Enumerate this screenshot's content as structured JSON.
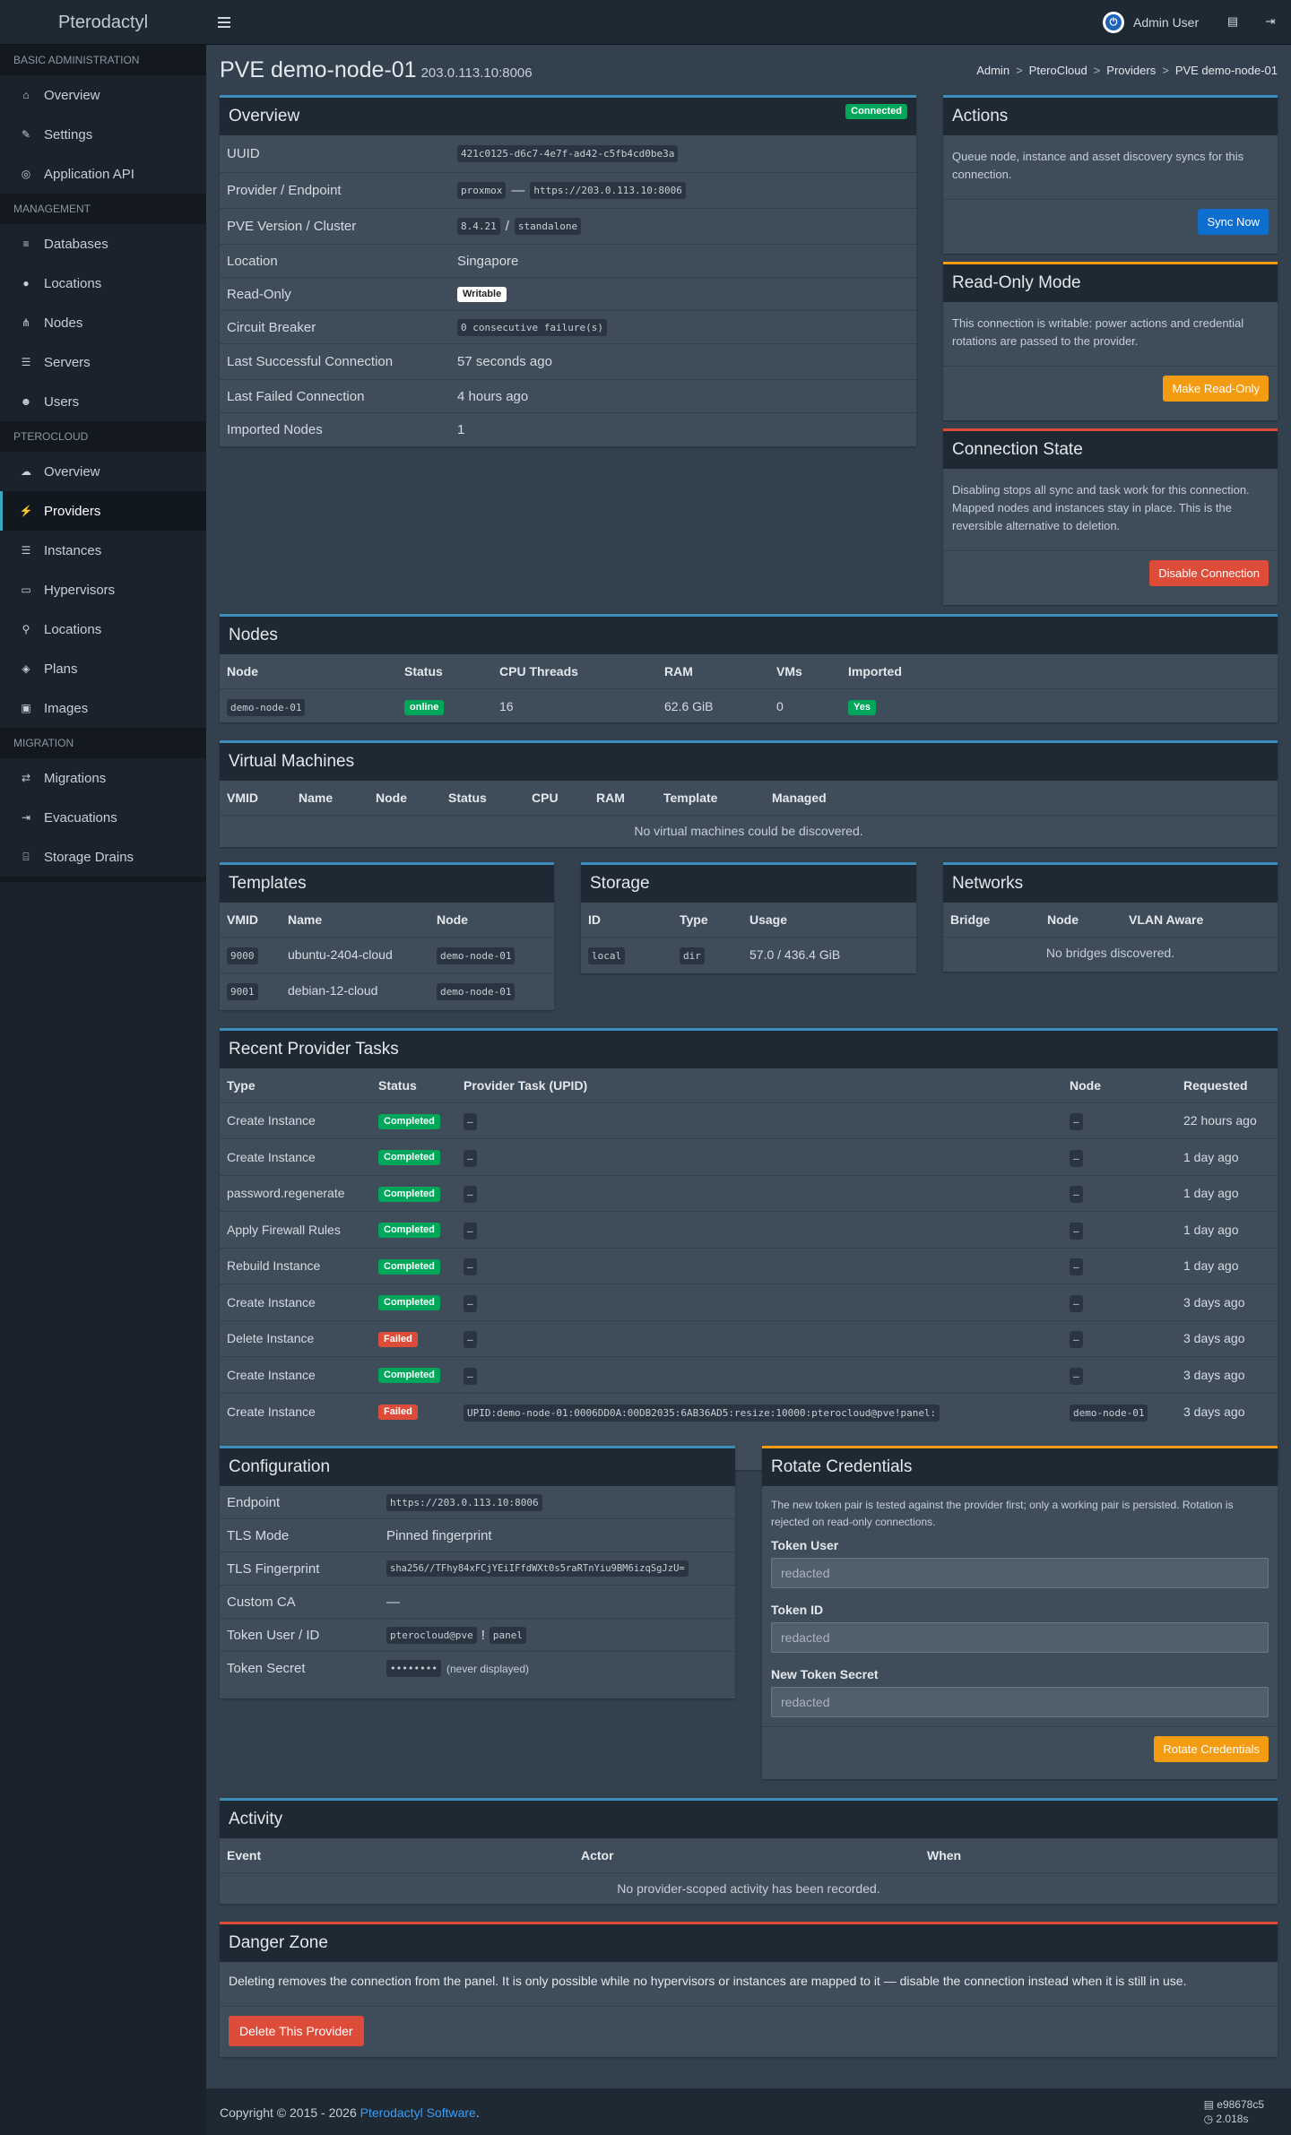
{
  "brand": "Pterodactyl",
  "user": {
    "name": "Admin User",
    "avatar_icon": "power-icon"
  },
  "sidebar": [
    {
      "header": "BASIC ADMINISTRATION",
      "items": [
        {
          "label": "Overview",
          "icon": "home-icon"
        },
        {
          "label": "Settings",
          "icon": "wrench-icon"
        },
        {
          "label": "Application API",
          "icon": "gamepad-icon"
        }
      ]
    },
    {
      "header": "MANAGEMENT",
      "items": [
        {
          "label": "Databases",
          "icon": "database-icon"
        },
        {
          "label": "Locations",
          "icon": "globe-icon"
        },
        {
          "label": "Nodes",
          "icon": "sitemap-icon"
        },
        {
          "label": "Servers",
          "icon": "list-icon"
        },
        {
          "label": "Users",
          "icon": "users-icon"
        }
      ]
    },
    {
      "header": "PTEROCLOUD",
      "items": [
        {
          "label": "Overview",
          "icon": "cloud-icon"
        },
        {
          "label": "Providers",
          "icon": "plug-icon",
          "active": true
        },
        {
          "label": "Instances",
          "icon": "list-icon"
        },
        {
          "label": "Hypervisors",
          "icon": "desktop-icon"
        },
        {
          "label": "Locations",
          "icon": "map-marker-icon"
        },
        {
          "label": "Plans",
          "icon": "cube-icon"
        },
        {
          "label": "Images",
          "icon": "image-icon"
        }
      ]
    },
    {
      "header": "MIGRATION",
      "items": [
        {
          "label": "Migrations",
          "icon": "exchange-icon"
        },
        {
          "label": "Evacuations",
          "icon": "sign-out-icon"
        },
        {
          "label": "Storage Drains",
          "icon": "hdd-icon"
        }
      ]
    }
  ],
  "page": {
    "title": "PVE demo-node-01",
    "subtitle": "203.0.113.10:8006",
    "breadcrumb": [
      "Admin",
      "PteroCloud",
      "Providers",
      "PVE demo-node-01"
    ],
    "sep": ">"
  },
  "overview": {
    "title": "Overview",
    "status_badge": "Connected",
    "uuid_label": "UUID",
    "uuid": "421c0125-d6c7-4e7f-ad42-c5fb4cd0be3a",
    "provider_label": "Provider / Endpoint",
    "provider": "proxmox",
    "dash": "—",
    "endpoint": "https://203.0.113.10:8006",
    "version_label": "PVE Version / Cluster",
    "version": "8.4.21",
    "slash": "/",
    "cluster": "standalone",
    "location_label": "Location",
    "location": "Singapore",
    "readonly_label": "Read-Only",
    "readonly": "Writable",
    "breaker_label": "Circuit Breaker",
    "breaker": "0 consecutive failure(s)",
    "last_success_label": "Last Successful Connection",
    "last_success": "57 seconds ago",
    "last_failed_label": "Last Failed Connection",
    "last_failed": "4 hours ago",
    "imported_label": "Imported Nodes",
    "imported": "1"
  },
  "actions": {
    "title": "Actions",
    "text": "Queue node, instance and asset discovery syncs for this connection.",
    "button": "Sync Now"
  },
  "readonly_mode": {
    "title": "Read-Only Mode",
    "text": "This connection is writable: power actions and credential rotations are passed to the provider.",
    "button": "Make Read-Only"
  },
  "connection_state": {
    "title": "Connection State",
    "text": "Disabling stops all sync and task work for this connection. Mapped nodes and instances stay in place. This is the reversible alternative to deletion.",
    "button": "Disable Connection"
  },
  "nodes": {
    "title": "Nodes",
    "columns": [
      "Node",
      "Status",
      "CPU Threads",
      "RAM",
      "VMs",
      "Imported"
    ],
    "rows": [
      {
        "node": "demo-node-01",
        "status": "online",
        "cpu": "16",
        "ram": "62.6 GiB",
        "vms": "0",
        "imported": "Yes"
      }
    ]
  },
  "vms": {
    "title": "Virtual Machines",
    "columns": [
      "VMID",
      "Name",
      "Node",
      "Status",
      "CPU",
      "RAM",
      "Template",
      "Managed"
    ],
    "empty": "No virtual machines could be discovered."
  },
  "templates": {
    "title": "Templates",
    "columns": [
      "VMID",
      "Name",
      "Node"
    ],
    "rows": [
      {
        "vmid": "9000",
        "name": "ubuntu-2404-cloud",
        "node": "demo-node-01"
      },
      {
        "vmid": "9001",
        "name": "debian-12-cloud",
        "node": "demo-node-01"
      }
    ]
  },
  "storage": {
    "title": "Storage",
    "columns": [
      "ID",
      "Type",
      "Usage"
    ],
    "rows": [
      {
        "id": "local",
        "type": "dir",
        "usage": "57.0 / 436.4 GiB"
      }
    ]
  },
  "networks": {
    "title": "Networks",
    "columns": [
      "Bridge",
      "Node",
      "VLAN Aware"
    ],
    "empty": "No bridges discovered."
  },
  "tasks": {
    "title": "Recent Provider Tasks",
    "columns": [
      "Type",
      "Status",
      "Provider Task (UPID)",
      "Node",
      "Requested"
    ],
    "rows": [
      {
        "type": "Create Instance",
        "status": "Completed",
        "upid": "–",
        "node": "–",
        "requested": "22 hours ago"
      },
      {
        "type": "Create Instance",
        "status": "Completed",
        "upid": "–",
        "node": "–",
        "requested": "1 day ago"
      },
      {
        "type": "password.regenerate",
        "status": "Completed",
        "upid": "–",
        "node": "–",
        "requested": "1 day ago"
      },
      {
        "type": "Apply Firewall Rules",
        "status": "Completed",
        "upid": "–",
        "node": "–",
        "requested": "1 day ago"
      },
      {
        "type": "Rebuild Instance",
        "status": "Completed",
        "upid": "–",
        "node": "–",
        "requested": "1 day ago"
      },
      {
        "type": "Create Instance",
        "status": "Completed",
        "upid": "–",
        "node": "–",
        "requested": "3 days ago"
      },
      {
        "type": "Delete Instance",
        "status": "Failed",
        "upid": "–",
        "node": "–",
        "requested": "3 days ago"
      },
      {
        "type": "Create Instance",
        "status": "Completed",
        "upid": "–",
        "node": "–",
        "requested": "3 days ago"
      },
      {
        "type": "Create Instance",
        "status": "Failed",
        "upid": "UPID:demo-node-01:0006DD0A:00DB2035:6AB36AD5:resize:10000:pterocloud@pve!panel:",
        "node": "demo-node-01",
        "requested": "3 days ago"
      }
    ]
  },
  "config": {
    "title": "Configuration",
    "endpoint_label": "Endpoint",
    "endpoint": "https://203.0.113.10:8006",
    "tls_mode_label": "TLS Mode",
    "tls_mode": "Pinned fingerprint",
    "tls_fp_label": "TLS Fingerprint",
    "tls_fp": "sha256//TFhy84xFCjYEiIFfdWXt0s5raRTnYiu9BM6izqSgJzU=",
    "ca_label": "Custom CA",
    "ca": "—",
    "token_label": "Token User / ID",
    "token_user": "pterocloud@pve",
    "bang": "!",
    "token_id": "panel",
    "secret_label": "Token Secret",
    "secret": "••••••••",
    "secret_note": "(never displayed)"
  },
  "rotate": {
    "title": "Rotate Credentials",
    "text": "The new token pair is tested against the provider first; only a working pair is persisted. Rotation is rejected on read-only connections.",
    "user_label": "Token User",
    "user_ph": "redacted",
    "id_label": "Token ID",
    "id_ph": "redacted",
    "secret_label": "New Token Secret",
    "secret_ph": "redacted",
    "button": "Rotate Credentials"
  },
  "activity": {
    "title": "Activity",
    "columns": [
      "Event",
      "Actor",
      "When"
    ],
    "empty": "No provider-scoped activity has been recorded."
  },
  "danger": {
    "title": "Danger Zone",
    "text": "Deleting removes the connection from the panel. It is only possible while no hypervisors or instances are mapped to it — disable the connection instead when it is still in use.",
    "button": "Delete This Provider"
  },
  "footer": {
    "copy": "Copyright © 2015 - 2026",
    "link": "Pterodactyl Software",
    "dot": ".",
    "hash": "e98678c5",
    "time": "2.018s"
  },
  "colors": {
    "accent": "#3c8dbc",
    "success": "#00a65a",
    "danger": "#dd4b39",
    "warning": "#f39c12",
    "primary": "#0d6ecf"
  }
}
